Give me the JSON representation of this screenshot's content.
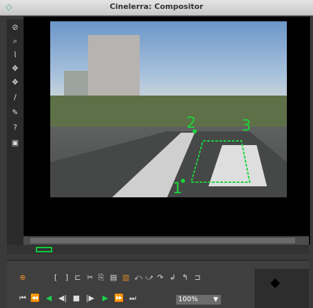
{
  "window": {
    "title": "Cinelerra: Compositor"
  },
  "tools": [
    {
      "name": "protect-icon",
      "glyph": "⊘"
    },
    {
      "name": "zoom-icon",
      "glyph": "⌕"
    },
    {
      "name": "mask-icon",
      "glyph": "⌇"
    },
    {
      "name": "translate-icon",
      "glyph": "✥"
    },
    {
      "name": "camera-icon",
      "glyph": "✥"
    },
    {
      "name": "crop-icon",
      "glyph": "/"
    },
    {
      "name": "eyedropper-icon",
      "glyph": "✎"
    },
    {
      "name": "help-icon",
      "glyph": "?"
    },
    {
      "name": "safe-region-icon",
      "glyph": "▣"
    }
  ],
  "overlay": {
    "labels": [
      "1",
      "2",
      "3"
    ],
    "accent": "#1bd43b"
  },
  "controls": {
    "zoom_value": "100%",
    "zoom_arrow": "▼",
    "edit_buttons": [
      "⊕",
      "[",
      "]",
      "⊏",
      "✂",
      "⎘",
      "▤",
      "▥",
      "⤺",
      "⤻",
      "↷",
      "↲",
      "↰",
      "⊐"
    ],
    "transport": [
      "⏮",
      "⏪",
      "◀",
      "◀|",
      "■",
      "|▶",
      "▶",
      "⏩",
      "⏭"
    ]
  }
}
